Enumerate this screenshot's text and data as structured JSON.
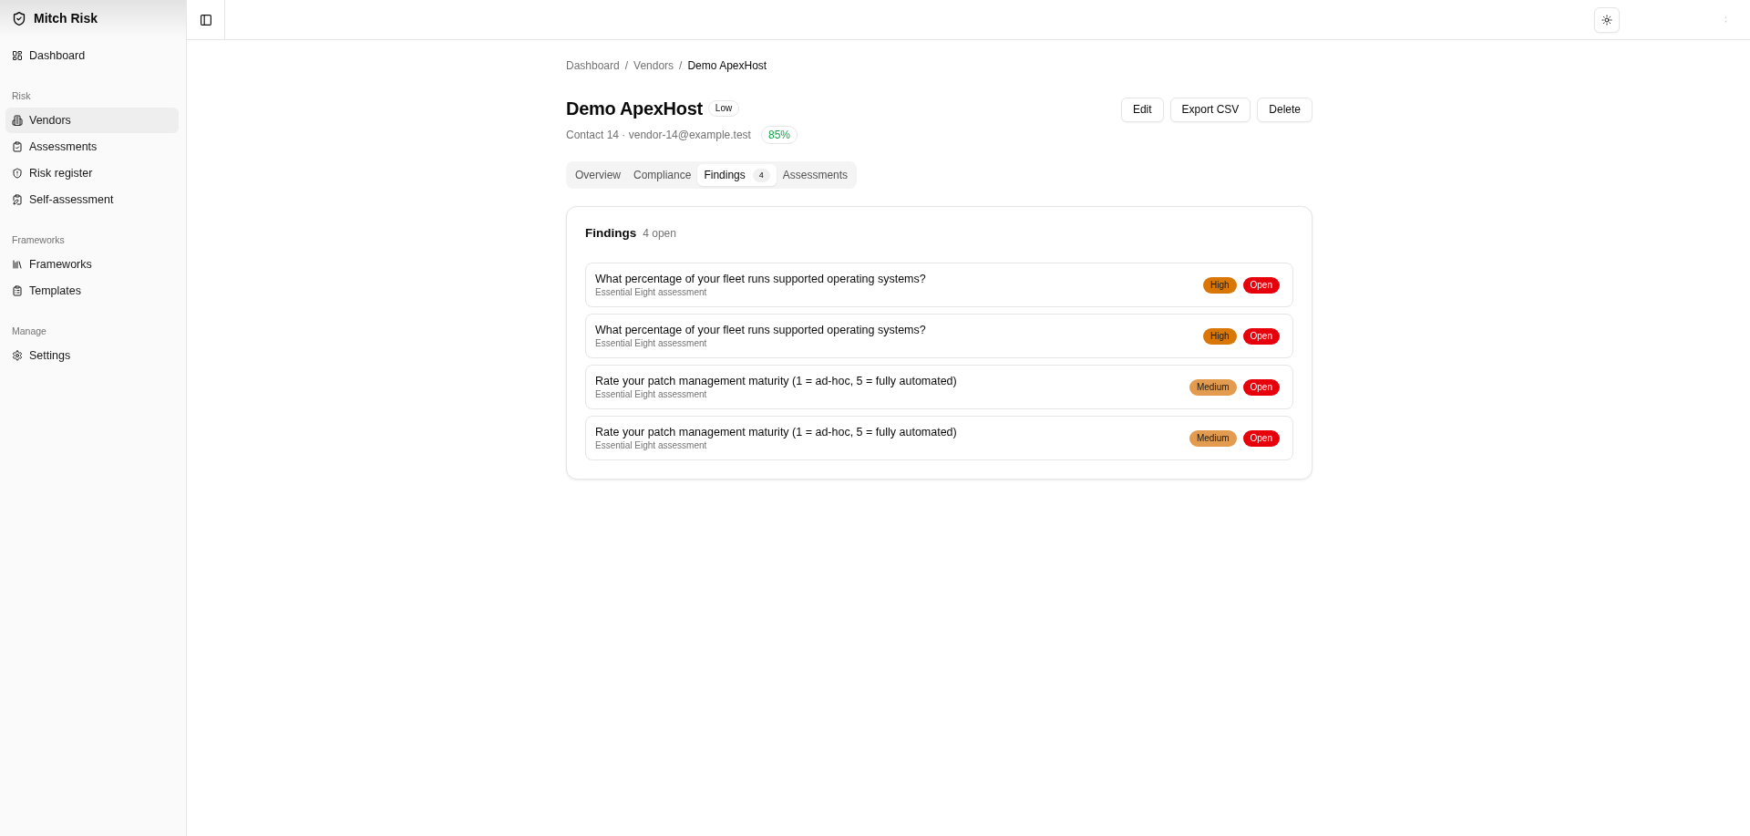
{
  "app": {
    "brand": "Mitch Risk"
  },
  "sidebar": {
    "sections": [
      {
        "items": [
          {
            "label": "Dashboard",
            "selected": false
          }
        ]
      },
      {
        "heading": "Risk",
        "items": [
          {
            "label": "Vendors",
            "selected": true
          },
          {
            "label": "Assessments",
            "selected": false
          },
          {
            "label": "Risk register",
            "selected": false
          },
          {
            "label": "Self-assessment",
            "selected": false
          }
        ]
      },
      {
        "heading": "Frameworks",
        "items": [
          {
            "label": "Frameworks",
            "selected": false
          },
          {
            "label": "Templates",
            "selected": false
          }
        ]
      },
      {
        "heading": "Manage",
        "items": [
          {
            "label": "Settings",
            "selected": false
          }
        ]
      }
    ]
  },
  "breadcrumb": [
    {
      "kind": "link",
      "text": "Dashboard"
    },
    {
      "kind": "separator",
      "text": "/"
    },
    {
      "kind": "link",
      "text": "Vendors"
    },
    {
      "kind": "separator",
      "text": "/"
    },
    {
      "kind": "current",
      "text": "Demo ApexHost"
    }
  ],
  "vendor": {
    "name": "Demo ApexHost",
    "tier": "Low",
    "contact": "Contact 14 · vendor-14@example.test",
    "score": "85%"
  },
  "actions": [
    "Edit",
    "Export CSV",
    "Delete"
  ],
  "tabs": [
    {
      "label": "Overview",
      "selected": false
    },
    {
      "label": "Compliance",
      "selected": false
    },
    {
      "label": "Findings",
      "selected": true,
      "count": "4"
    },
    {
      "label": "Assessments",
      "selected": false
    }
  ],
  "findings": {
    "title": "Findings",
    "summary": "4 open",
    "items": [
      {
        "title": "What percentage of your fleet runs supported operating systems?",
        "source": "Essential Eight assessment",
        "severity": {
          "label": "High",
          "color": "#d97706"
        },
        "status": {
          "label": "Open",
          "color": "#e7000b"
        }
      },
      {
        "title": "What percentage of your fleet runs supported operating systems?",
        "source": "Essential Eight assessment",
        "severity": {
          "label": "High",
          "color": "#d97706"
        },
        "status": {
          "label": "Open",
          "color": "#e7000b"
        }
      },
      {
        "title": "Rate your patch management maturity (1 = ad-hoc, 5 = fully automated)",
        "source": "Essential Eight assessment",
        "severity": {
          "label": "Medium",
          "color": "#e39b4f"
        },
        "status": {
          "label": "Open",
          "color": "#e7000b"
        }
      },
      {
        "title": "Rate your patch management maturity (1 = ad-hoc, 5 = fully automated)",
        "source": "Essential Eight assessment",
        "severity": {
          "label": "Medium",
          "color": "#e39b4f"
        },
        "status": {
          "label": "Open",
          "color": "#e7000b"
        }
      }
    ]
  }
}
